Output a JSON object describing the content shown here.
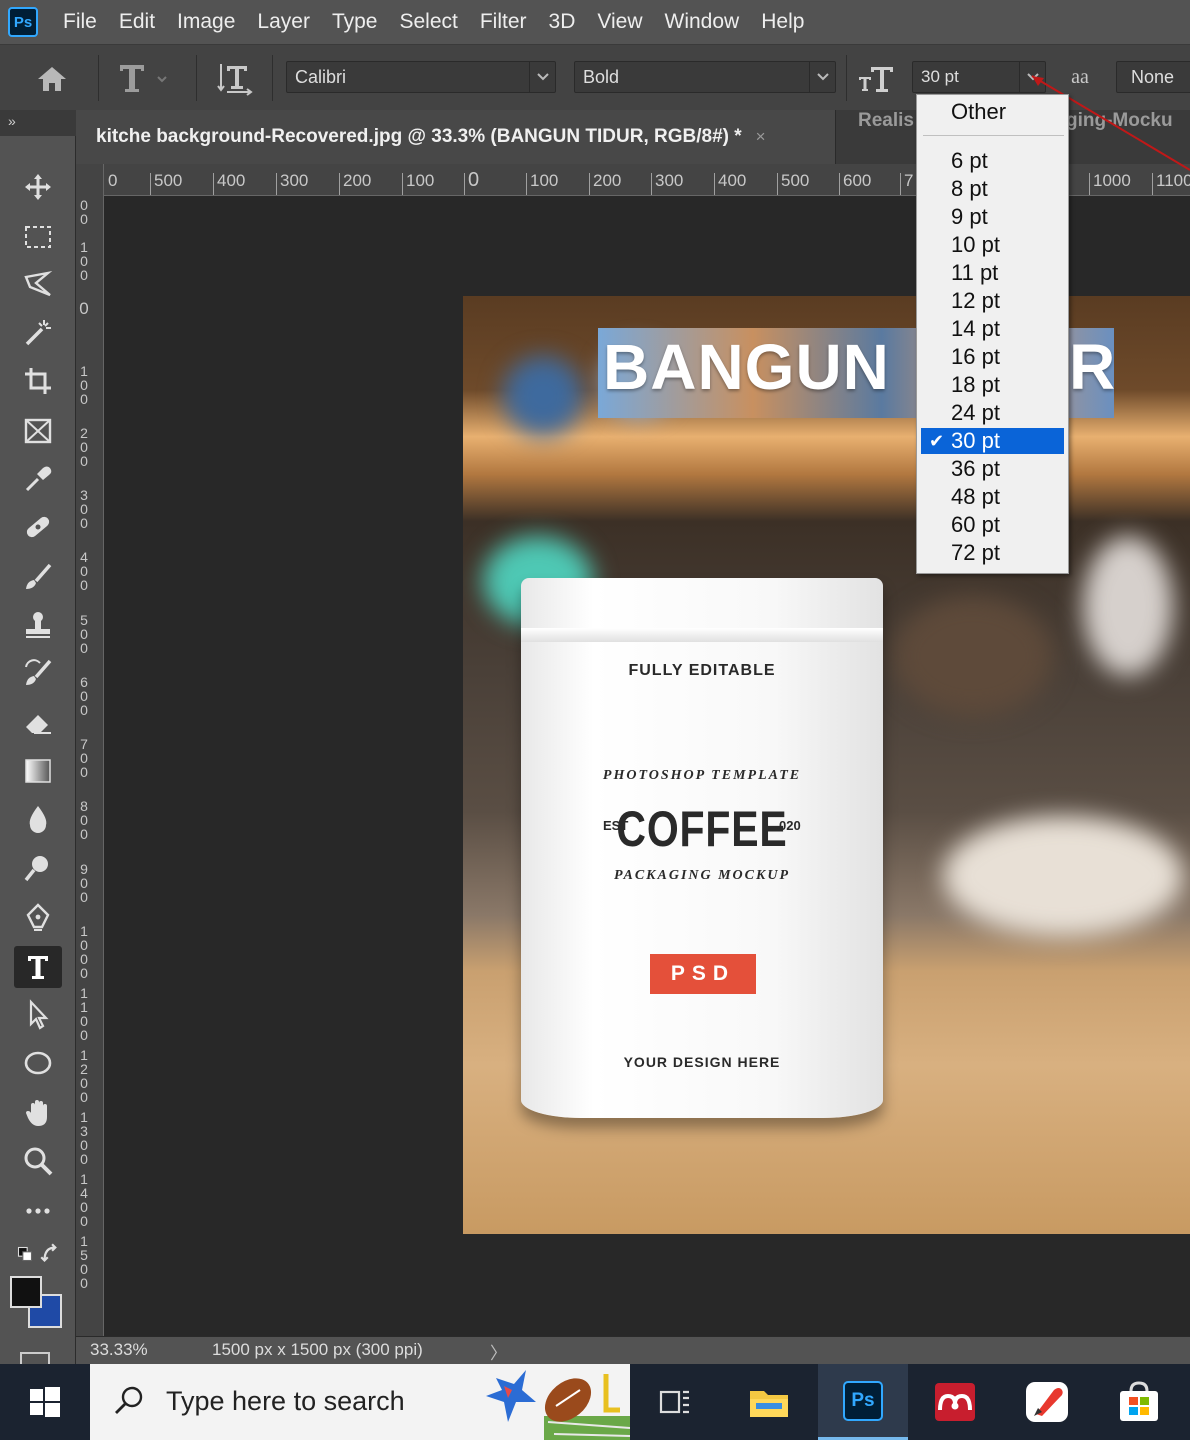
{
  "menubar": {
    "logo": "Ps",
    "items": [
      "File",
      "Edit",
      "Image",
      "Layer",
      "Type",
      "Select",
      "Filter",
      "3D",
      "View",
      "Window",
      "Help"
    ]
  },
  "options": {
    "font_family": "Calibri",
    "font_style": "Bold",
    "font_size": "30 pt",
    "antialias_glyph": "aa",
    "antialias": "None"
  },
  "panel_strip": {
    "collapse": "»"
  },
  "tabs": {
    "active_title": "kitche background-Recovered.jpg @ 33.3% (BANGUN TIDUR, RGB/8#) *",
    "close": "×",
    "second": "Realis",
    "third": "ging-Mocku"
  },
  "ruler": {
    "top_labels": [
      "0",
      "500",
      "400",
      "300",
      "200",
      "100",
      "0",
      "100",
      "200",
      "300",
      "400",
      "500",
      "600",
      "7",
      "1000",
      "1100"
    ],
    "left_labels": [
      "00",
      "100",
      "0",
      "100",
      "200",
      "300",
      "400",
      "500",
      "600",
      "700",
      "800",
      "900",
      "1000",
      "1100",
      "1200",
      "1300",
      "1400",
      "1500"
    ]
  },
  "document": {
    "banner_text": "BANGUN",
    "banner_tail": "R",
    "pouch": {
      "top_text": "FULLY EDITABLE",
      "arc_top": "PHOTOSHOP TEMPLATE",
      "est": "EST",
      "brand": "COFFEE",
      "year": "020",
      "arc_bottom": "PACKAGING MOCKUP",
      "badge": "PSD",
      "bottom_text": "YOUR DESIGN HERE"
    }
  },
  "size_menu": {
    "other": "Other",
    "sizes": [
      "6 pt",
      "8 pt",
      "9 pt",
      "10 pt",
      "11 pt",
      "12 pt",
      "14 pt",
      "16 pt",
      "18 pt",
      "24 pt",
      "30 pt",
      "36 pt",
      "48 pt",
      "60 pt",
      "72 pt"
    ],
    "selected": "30 pt",
    "check": "✔"
  },
  "status": {
    "zoom": "33.33%",
    "doc_size": "1500 px x 1500 px (300 ppi)",
    "arrow": "〉"
  },
  "taskbar": {
    "search_placeholder": "Type here to search"
  },
  "colors": {
    "accent_blue": "#0a64d8",
    "psd_badge": "#e4503a",
    "ps_logo": "#31a8ff"
  }
}
